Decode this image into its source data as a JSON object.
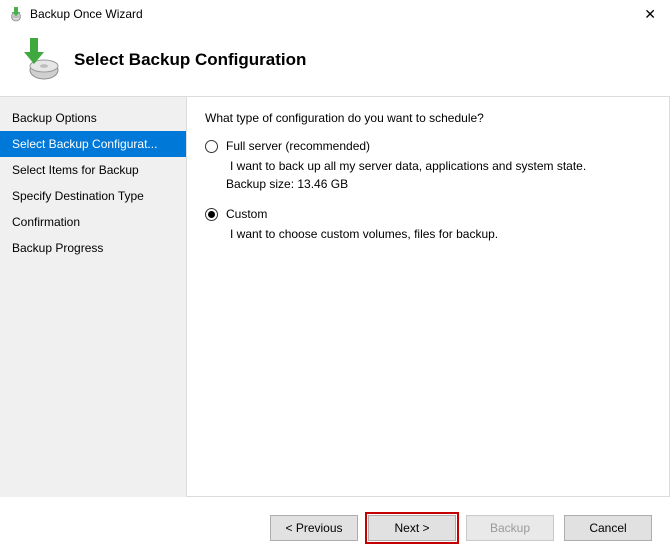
{
  "window": {
    "title": "Backup Once Wizard",
    "close_glyph": "✕"
  },
  "header": {
    "title": "Select Backup Configuration"
  },
  "sidebar": {
    "items": [
      {
        "label": "Backup Options",
        "selected": false
      },
      {
        "label": "Select Backup Configurat...",
        "selected": true
      },
      {
        "label": "Select Items for Backup",
        "selected": false
      },
      {
        "label": "Specify Destination Type",
        "selected": false
      },
      {
        "label": "Confirmation",
        "selected": false
      },
      {
        "label": "Backup Progress",
        "selected": false
      }
    ]
  },
  "main": {
    "question": "What type of configuration do you want to schedule?",
    "options": [
      {
        "value": "full",
        "label": "Full server (recommended)",
        "desc": "I want to back up all my server data, applications and system state.",
        "extra": "Backup size: 13.46 GB",
        "checked": false
      },
      {
        "value": "custom",
        "label": "Custom",
        "desc": "I want to choose custom volumes, files for backup.",
        "extra": "",
        "checked": true
      }
    ]
  },
  "footer": {
    "previous": "< Previous",
    "next": "Next >",
    "backup": "Backup",
    "cancel": "Cancel"
  },
  "colors": {
    "accent": "#0078d7",
    "highlight": "#c40000"
  }
}
